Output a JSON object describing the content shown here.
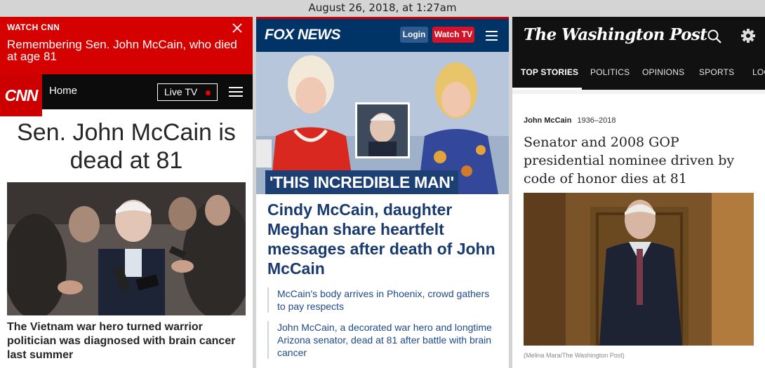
{
  "timestamp": "August 26, 2018, at 1:27am",
  "cnn": {
    "alert_kicker": "WATCH CNN",
    "alert_text": "Remembering Sen. John McCain, who died at age 81",
    "logo": "CNN",
    "nav_home": "Home",
    "live_tv": "Live TV",
    "headline": "Sen. John McCain is dead at 81",
    "caption": "The Vietnam war hero turned warrior politician was diagnosed with brain cancer last summer",
    "icons": {
      "close": "close-icon",
      "menu": "hamburger-menu-icon",
      "live": "live-dot-icon"
    },
    "colors": {
      "brand_red": "#cc0000",
      "alert_red": "#d50000",
      "nav": "#0c0c0c"
    }
  },
  "fox": {
    "logo": "FOX NEWS",
    "login": "Login",
    "watch_tv": "Watch TV",
    "badge": "'THIS INCREDIBLE MAN'",
    "headline": "Cindy McCain, daughter Meghan share heartfelt messages after death of John McCain",
    "related": [
      "McCain's body arrives in Phoenix, crowd gathers to pay respects",
      "John McCain, a decorated war hero and longtime Arizona senator, dead at 81 after battle with brain cancer"
    ],
    "colors": {
      "nav": "#003366",
      "watch_tv": "#d3132a",
      "headline": "#183a6e"
    }
  },
  "wapo": {
    "logo": "The Washington Post",
    "tabs": [
      "TOP STORIES",
      "POLITICS",
      "OPINIONS",
      "SPORTS",
      "LOCAL"
    ],
    "kicker_name": "John McCain",
    "kicker_years": "1936–2018",
    "headline": "Senator and 2008 GOP presidential nominee driven by code of honor dies at 81",
    "credit": "(Melina Mara/The Washington Post)",
    "icons": {
      "search": "search-icon",
      "settings": "gear-icon"
    }
  }
}
